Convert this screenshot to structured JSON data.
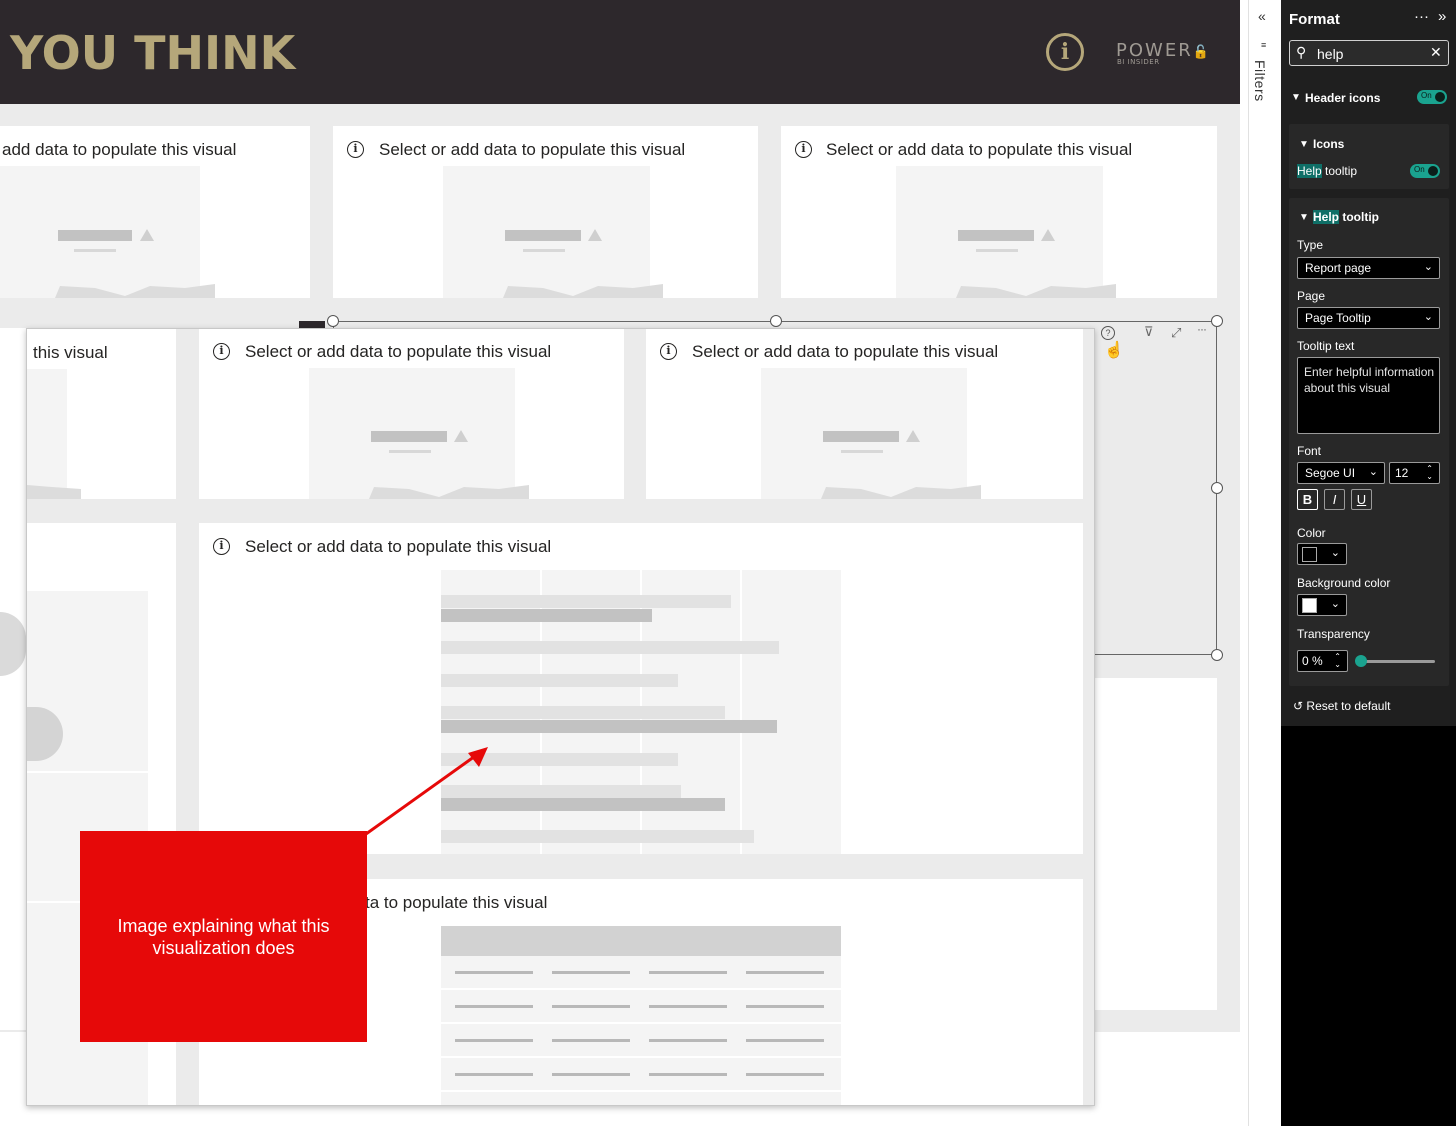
{
  "report": {
    "banner_title": "YOU THINK",
    "banner_info_glyph": "i",
    "logo_main": "POWER",
    "logo_lock": "🔓",
    "logo_sub": "BI INSIDER",
    "placeholder_full": "Select or add data to populate this visual",
    "placeholder_cut_top_left": "add data to populate this visual",
    "placeholder_cut_overlay_left": "this visual",
    "placeholder_cut_bottom": "ta to populate this visual",
    "info_glyph": "i"
  },
  "header_icons": {
    "help": "?",
    "filter": "⊽",
    "focus": "⤢",
    "more": "···"
  },
  "callout": {
    "text": "Image explaining what this\nvisualization does",
    "color": "#e60909"
  },
  "filters_pane": {
    "collapse_glyph": "«",
    "label": "Filters"
  },
  "format_pane": {
    "title": "Format",
    "more_glyph": "···",
    "expand_glyph": "»",
    "search": {
      "icon": "search-icon",
      "value": "help",
      "clear_glyph": "✕"
    },
    "header_icons_section": {
      "label": "Header icons",
      "toggle": "On"
    },
    "icons_section": {
      "label": "Icons",
      "help_tooltip_prefix": "Help",
      "help_tooltip_suffix": " tooltip",
      "toggle": "On"
    },
    "help_tooltip_section": {
      "label_prefix": "Help",
      "label_suffix": " tooltip",
      "type_label": "Type",
      "type_value": "Report page",
      "page_label": "Page",
      "page_value": "Page Tooltip",
      "tooltip_text_label": "Tooltip text",
      "tooltip_text_placeholder": "Enter helpful information about this visual",
      "font_label": "Font",
      "font_value": "Segoe UI",
      "font_size": "12",
      "bold": "B",
      "italic": "I",
      "underline": "U",
      "color_label": "Color",
      "color_value": "#000000",
      "background_label": "Background color",
      "background_value": "#ffffff",
      "transparency_label": "Transparency",
      "transparency_value": "0 %",
      "transparency_fraction": 0.0
    },
    "reset_label": "Reset to default",
    "accent_color": "#1aa38f",
    "highlight_color": "#0f6f67"
  }
}
